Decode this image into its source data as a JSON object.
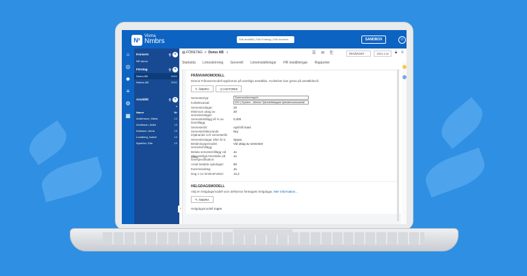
{
  "app": {
    "logo_mark": "N²",
    "logo_line1": "Visma",
    "logo_line2": "Nmbrs",
    "search_placeholder": "Sök anställd | Sök Företag | Sök konsern",
    "sandbox_label": "SANDBOX"
  },
  "sidebar": {
    "konsern": {
      "label": "Konsern",
      "items": [
        {
          "name": "NR demo",
          "count": ""
        }
      ]
    },
    "foretag": {
      "label": "Företag",
      "items": [
        {
          "name": "Demo AB",
          "count": "0001"
        },
        {
          "name": "Nmbrs AB",
          "count": "0001"
        }
      ]
    },
    "anstalld": {
      "label": "Anställd",
      "col_name": "Namn",
      "col_nr": "Nr",
      "items": [
        {
          "name": "Andersson, Maria",
          "count": "14"
        },
        {
          "name": "Arvidsson, Anita",
          "count": "13"
        },
        {
          "name": "Karlsson, Anna",
          "count": "13"
        },
        {
          "name": "Lundberg, Isabel",
          "count": "12"
        },
        {
          "name": "Nyström, Ella",
          "count": "10"
        }
      ]
    }
  },
  "header": {
    "crumb_root": "FÖRETAG",
    "crumb_sep": ">",
    "crumb_current": "Demo AB",
    "arsdrop": "ÅRSÅRDER",
    "year": "2021-1-M"
  },
  "tabs": [
    "Startsida",
    "Löneskörning",
    "Generell",
    "Löneinställningar",
    "HR inställningar",
    "Rapporter"
  ],
  "franvaro": {
    "title": "FRÅNVAROMODELL",
    "desc": "Denna Frånvaromodell appliceras på samtliga anställda. Avvikelser kan göras på anställdnivå.",
    "edit_label": "ÄNDRA",
    "history_label": "HISTORIK",
    "fields": [
      {
        "k": "Semestertyp:",
        "v": "Sammanlöneregeln",
        "select": true
      },
      {
        "k": "Kollektivavtal:",
        "v": "200 | System - Allmän Tjänstelfstagare tjänstemannaavtal",
        "select": true
      },
      {
        "k": "Semesterdagar:",
        "v": "25"
      },
      {
        "k": "Minimum uttag av semesterdagar:",
        "v": "20"
      },
      {
        "k": "Semestertillägg till % av lönetillägg:",
        "v": "0,400"
      },
      {
        "k": "Semesterår:",
        "v": "April till mars"
      },
      {
        "k": "Semesterfaktorande intjänande och semesterår:",
        "v": "Nej"
      },
      {
        "k": "Semesterdagar efter år 5:",
        "v": "Spara"
      },
      {
        "k": "Betalningsperioden semestertillägg:",
        "v": "Vid uttag av semester"
      },
      {
        "k": "Betala semestertillägg vid uttag:",
        "v": "Ja"
      },
      {
        "k": "Visa vänliga lönedelar på lönespecifikation:",
        "v": "Ja"
      },
      {
        "k": "Antal betalda sjukdagar:",
        "v": "90"
      },
      {
        "k": "Karensavdrag:",
        "v": "Ja"
      },
      {
        "k": "Dag 1-14 timlöneFaktor:",
        "v": "12,2"
      }
    ]
  },
  "helgdag": {
    "title": "HELGDAGSMODELL",
    "desc": "Välj en helgdagsmodell som definierar företagets helgdagar.",
    "more": "Mer information...",
    "edit_label": "ÄNDRA",
    "k": "Helgdagsmodell:",
    "v": "Ingen"
  },
  "colors": {
    "brand": "#0d63c2",
    "sidebar": "#174a93",
    "background": "#2f8fe3"
  }
}
